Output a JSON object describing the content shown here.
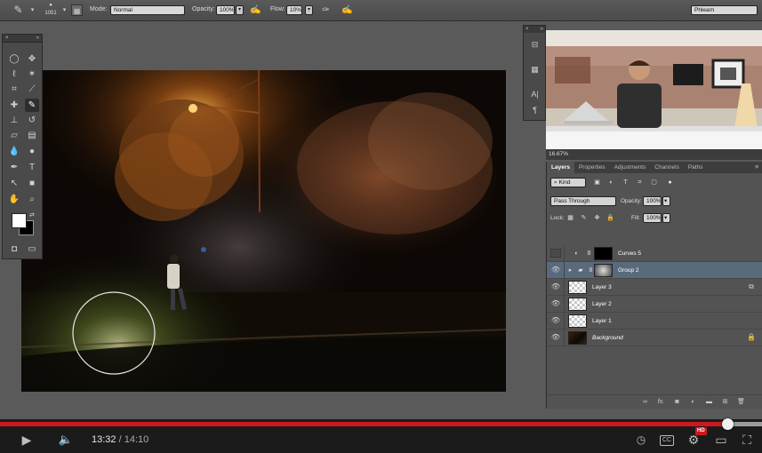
{
  "options_bar": {
    "brush_size": "1051",
    "mode_label": "Mode:",
    "mode_value": "Normal",
    "opacity_label": "Opacity:",
    "opacity_value": "100%",
    "flow_label": "Flow:",
    "flow_value": "10%",
    "workspace_value": "Phlearn",
    "icons": [
      "brush-icon",
      "brush-preset-icon",
      "toggle-brush-panel-icon",
      "pressure-opacity-icon",
      "airbrush-icon",
      "pressure-size-icon"
    ]
  },
  "tools_panel": {
    "header_left": "×",
    "header_right": "»",
    "tools": [
      "ellipse-marquee-icon",
      "move-icon",
      "lasso-icon",
      "magic-wand-icon",
      "crop-icon",
      "eyedropper-icon",
      "healing-brush-icon",
      "brush-icon",
      "clone-stamp-icon",
      "history-brush-icon",
      "eraser-icon",
      "gradient-icon",
      "blur-icon",
      "dodge-icon",
      "pen-icon",
      "type-icon",
      "path-selection-icon",
      "rectangle-shape-icon",
      "hand-icon",
      "zoom-icon",
      "quick-mask-icon",
      "screen-mode-icon"
    ],
    "foreground_color": "#ffffff",
    "background_color": "#000000"
  },
  "side_panel": {
    "header_left": "×",
    "header_right": "»",
    "icons": [
      "adjustments-icon",
      "properties-icon",
      "character-icon",
      "paragraph-icon"
    ],
    "character_glyph": "A|",
    "paragraph_glyph": "¶"
  },
  "navigator": {
    "zoom": "16.67%"
  },
  "layers_panel": {
    "tabs": [
      "Layers",
      "Properties",
      "Adjustments",
      "Channels",
      "Paths"
    ],
    "active_tab": "Layers",
    "filter_kind": "Kind",
    "blend_mode": "Pass Through",
    "opacity_label": "Opacity:",
    "opacity_value": "100%",
    "lock_label": "Lock:",
    "fill_label": "Fill:",
    "fill_value": "100%",
    "layers": [
      {
        "name": "Curves 5",
        "visible": false,
        "type": "adjustment"
      },
      {
        "name": "Group 2",
        "visible": true,
        "type": "group",
        "selected": true
      },
      {
        "name": "Layer 3",
        "visible": true,
        "type": "pixel",
        "smart": true
      },
      {
        "name": "Layer 2",
        "visible": true,
        "type": "pixel"
      },
      {
        "name": "Layer 1",
        "visible": true,
        "type": "pixel"
      },
      {
        "name": "Background",
        "visible": true,
        "type": "background",
        "locked": true
      }
    ],
    "footer_icons": [
      "link-layers-icon",
      "fx-icon",
      "add-mask-icon",
      "new-adjustment-icon",
      "new-group-icon",
      "new-layer-icon",
      "delete-layer-icon"
    ],
    "fx_label": "fx."
  },
  "player": {
    "current_time": "13:32",
    "separator": " / ",
    "duration": "14:10",
    "progress_fraction": 0.955,
    "buffered_fraction": 1.0,
    "hd_label": "HD",
    "cc_label": "CC",
    "accent_color": "#cc181e"
  }
}
